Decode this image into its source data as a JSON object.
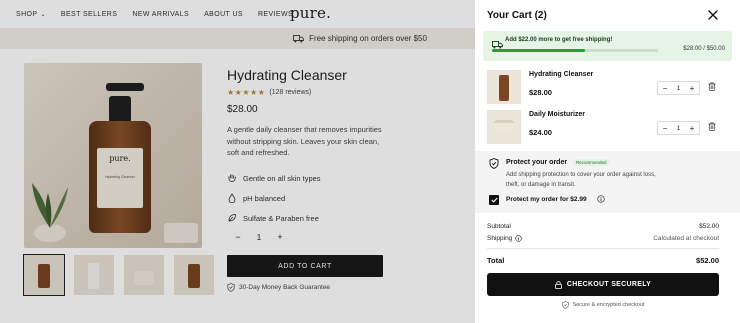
{
  "nav": {
    "items": [
      {
        "label": "SHOP"
      },
      {
        "label": "BEST SELLERS"
      },
      {
        "label": "NEW ARRIVALS"
      },
      {
        "label": "ABOUT US"
      },
      {
        "label": "REVIEWS"
      }
    ],
    "logo": "pure."
  },
  "promo": {
    "text": "Free shipping on orders over $50"
  },
  "product": {
    "image_logo": "pure.",
    "image_label": "Hydrating Cleanser",
    "title": "Hydrating Cleanser",
    "stars": "★★★★★",
    "rating": 4.5,
    "reviews": "(128 reviews)",
    "price": "$28.00",
    "description": "A gentle daily cleanser that removes impurities without stripping skin. Leaves your skin clean, soft and refreshed.",
    "features": [
      {
        "label": "Gentle on all skin types",
        "icon": "hand-icon"
      },
      {
        "label": "pH balanced",
        "icon": "drop-icon"
      },
      {
        "label": "Sulfate & Paraben free",
        "icon": "leaf-icon"
      }
    ],
    "quantity": "1",
    "add_to_cart": "ADD TO CART",
    "guarantee": "30-Day Money Back Guarantee"
  },
  "cart": {
    "title": "Your Cart (2)",
    "shipping": {
      "message": "Add $22.00 more to get free shipping!",
      "amount": "$28.00 / $50.00",
      "progress": 0.56
    },
    "items": [
      {
        "name": "Hydrating Cleanser",
        "price": "$28.00",
        "qty": "1"
      },
      {
        "name": "Daily Moisturizer",
        "price": "$24.00",
        "qty": "1"
      }
    ],
    "protection": {
      "title": "Protect your order",
      "badge": "Recommended",
      "description": "Add shipping protection to cover your order against loss, theft, or damage in transit.",
      "checkbox_label": "Protect my order for $2.99",
      "checked": true
    },
    "subtotal_label": "Subtotal",
    "subtotal_value": "$52.00",
    "shipping_label": "Shipping",
    "shipping_value": "Calculated at checkout",
    "total_label": "Total",
    "total_value": "$52.00",
    "checkout_label": "CHECKOUT SECURELY",
    "secure_text": "Secure & encrypted checkout"
  },
  "colors": {
    "accent": "#2c9a3d",
    "button": "#111111",
    "promo_bg": "#f1ede6",
    "ship_bg": "#e6f4e5"
  }
}
